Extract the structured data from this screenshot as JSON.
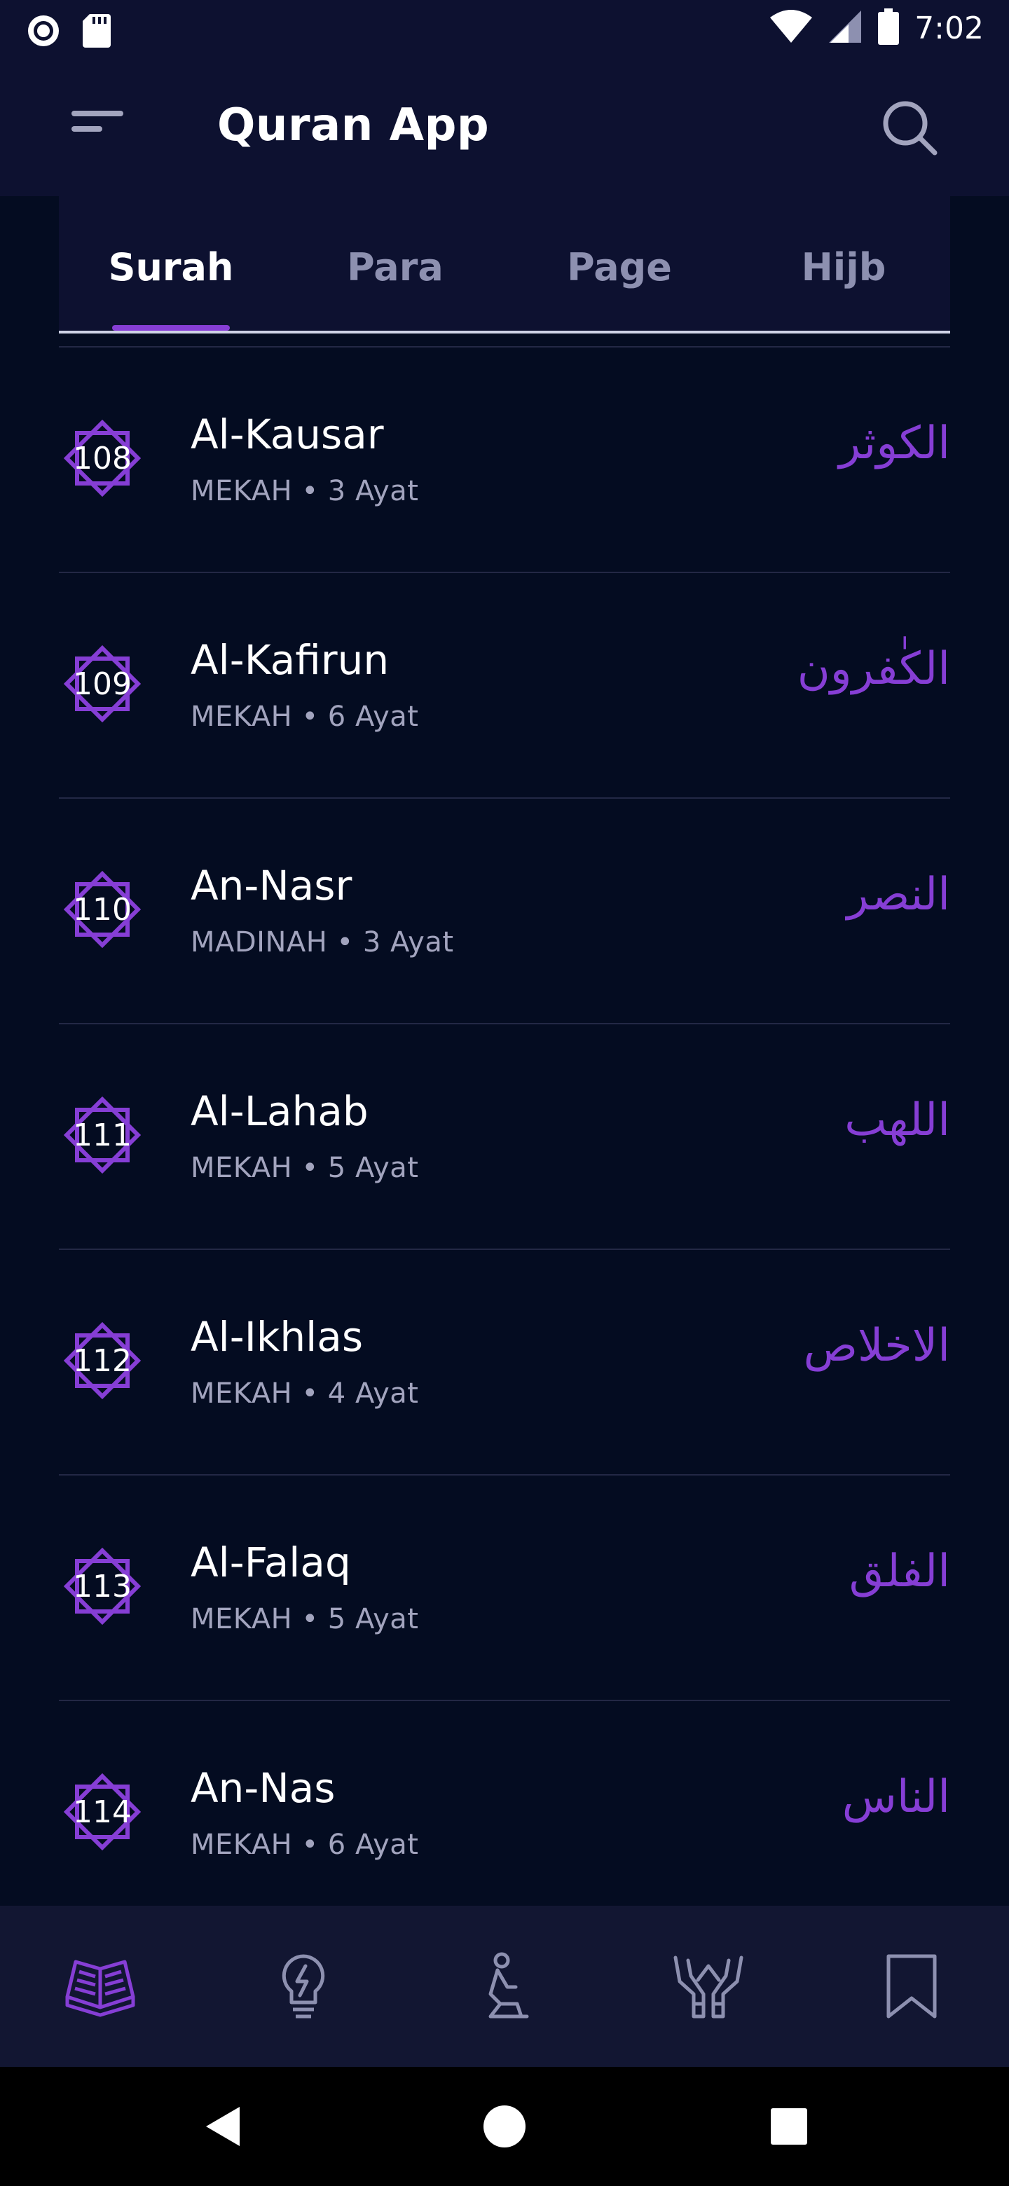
{
  "status_bar": {
    "time": "7:02",
    "icons": [
      "record-icon",
      "sd-card-icon",
      "wifi-icon",
      "signal-icon",
      "battery-icon"
    ]
  },
  "app_bar": {
    "title": "Quran App",
    "menu_icon": "menu-icon",
    "search_icon": "search-icon"
  },
  "tabs": [
    {
      "label": "Surah",
      "active": true
    },
    {
      "label": "Para",
      "active": false
    },
    {
      "label": "Page",
      "active": false
    },
    {
      "label": "Hijb",
      "active": false
    }
  ],
  "surahs": [
    {
      "number": "108",
      "name": "Al-Kausar",
      "meta": "MEKAH • 3 Ayat",
      "arabic": "الكوثر"
    },
    {
      "number": "109",
      "name": "Al-Kafirun",
      "meta": "MEKAH • 6 Ayat",
      "arabic": "الكٰفرون"
    },
    {
      "number": "110",
      "name": "An-Nasr",
      "meta": "MADINAH • 3 Ayat",
      "arabic": "النصر"
    },
    {
      "number": "111",
      "name": "Al-Lahab",
      "meta": "MEKAH • 5 Ayat",
      "arabic": "اللهب"
    },
    {
      "number": "112",
      "name": "Al-Ikhlas",
      "meta": "MEKAH • 4 Ayat",
      "arabic": "الاخلاص"
    },
    {
      "number": "113",
      "name": "Al-Falaq",
      "meta": "MEKAH • 5 Ayat",
      "arabic": "الفلق"
    },
    {
      "number": "114",
      "name": "An-Nas",
      "meta": "MEKAH • 6 Ayat",
      "arabic": "الناس"
    }
  ],
  "bottom_nav": [
    "quran-book-icon",
    "lamp-icon",
    "prayer-icon",
    "doa-hands-icon",
    "bookmark-icon"
  ],
  "colors": {
    "background": "#040c21",
    "app_bar": "#0d1130",
    "accent": "#863ed5",
    "muted_text": "#a2a4be",
    "tab_inactive": "#8d90b0"
  }
}
